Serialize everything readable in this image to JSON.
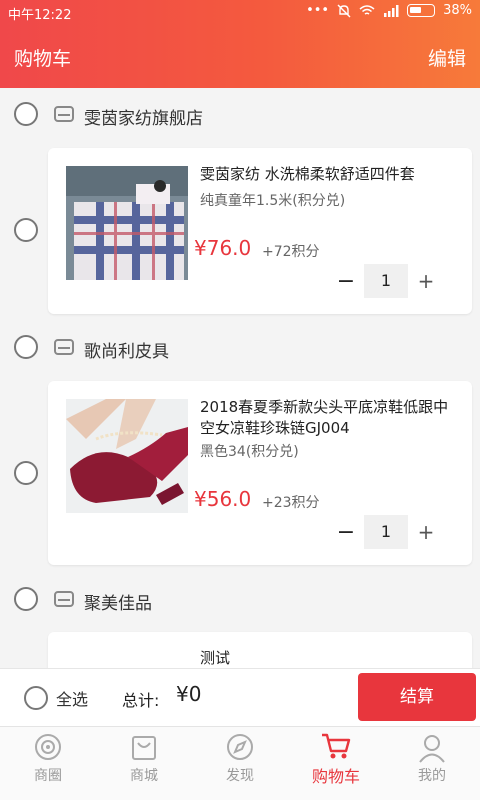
{
  "status_bar": {
    "time": "中午12:22",
    "dots": "•••",
    "battery": "38%"
  },
  "header": {
    "title": "购物车",
    "edit": "编辑"
  },
  "shops": [
    {
      "name": "雯茵家纺旗舰店",
      "product": {
        "name": "雯茵家纺 水洗棉柔软舒适四件套",
        "spec": "纯真童年1.5米(积分兑)",
        "price": "¥76.0",
        "points": "+72积分",
        "quantity": "1"
      }
    },
    {
      "name": "歌尚利皮具",
      "product": {
        "name": "2018春夏季新款尖头平底凉鞋低跟中空女凉鞋珍珠链GJ004",
        "spec": "黑色34(积分兑)",
        "price": "¥56.0",
        "points": "+23积分",
        "quantity": "1"
      }
    },
    {
      "name": "聚美佳品",
      "product": {
        "name": "测试"
      }
    }
  ],
  "stepper": {
    "minus": "−",
    "plus": "+"
  },
  "checkout": {
    "select_all": "全选",
    "total_label": "总计:",
    "total_value": "¥0",
    "pay_button": "结算"
  },
  "tabbar": [
    {
      "label": "商圈",
      "icon": "broadcast-icon"
    },
    {
      "label": "商城",
      "icon": "shopping-bag-icon"
    },
    {
      "label": "发现",
      "icon": "compass-icon"
    },
    {
      "label": "购物车",
      "icon": "cart-icon",
      "active": true
    },
    {
      "label": "我的",
      "icon": "user-icon"
    }
  ],
  "colors": {
    "accent": "#e8363d",
    "header_start": "#f0484a",
    "header_end": "#f77a3a"
  }
}
